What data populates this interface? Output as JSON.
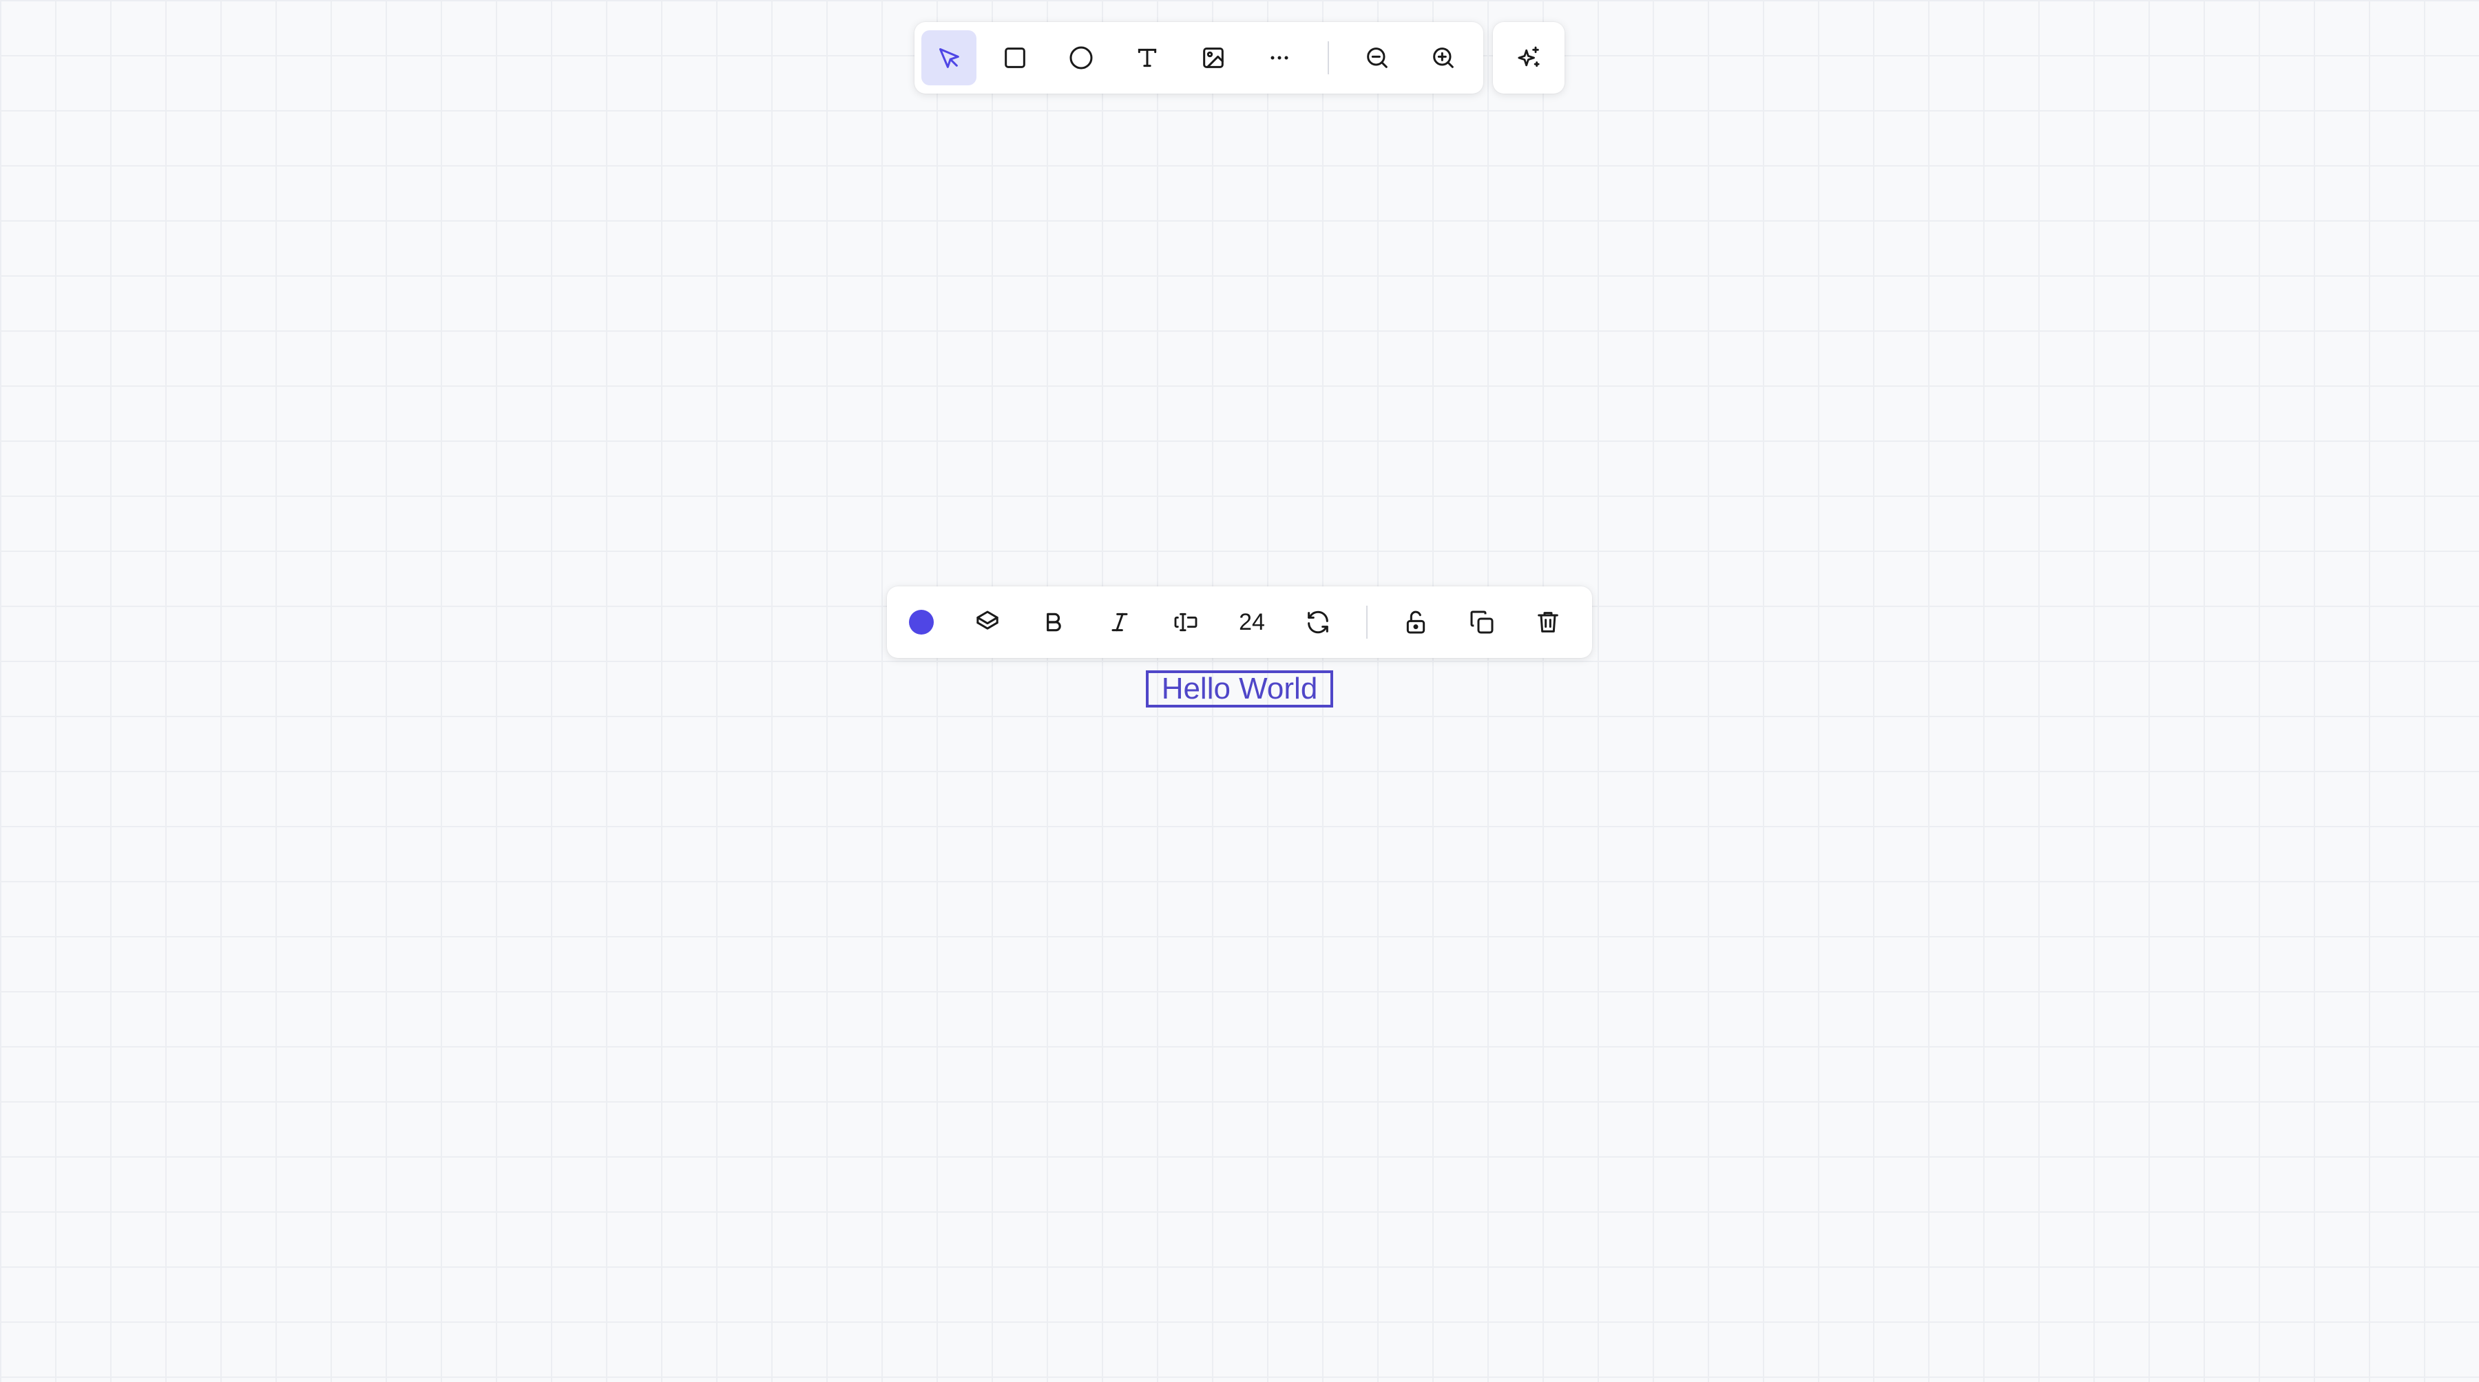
{
  "main_toolbar": {
    "tools": [
      {
        "name": "select",
        "icon": "cursor-icon",
        "active": true
      },
      {
        "name": "rectangle",
        "icon": "square-icon",
        "active": false
      },
      {
        "name": "ellipse",
        "icon": "circle-icon",
        "active": false
      },
      {
        "name": "text",
        "icon": "text-icon",
        "active": false
      },
      {
        "name": "image",
        "icon": "image-icon",
        "active": false
      },
      {
        "name": "more",
        "icon": "more-horizontal-icon",
        "active": false
      }
    ],
    "zoom": [
      {
        "name": "zoom-out",
        "icon": "zoom-out-icon"
      },
      {
        "name": "zoom-in",
        "icon": "zoom-in-icon"
      }
    ]
  },
  "ai_toolbar": {
    "icon": "sparkles-icon"
  },
  "element_toolbar": {
    "color": "#4f46e5",
    "font_size": "24",
    "buttons": [
      {
        "name": "color",
        "icon": "color-dot-icon"
      },
      {
        "name": "layers",
        "icon": "layers-icon"
      },
      {
        "name": "bold",
        "icon": "bold-icon"
      },
      {
        "name": "italic",
        "icon": "italic-icon"
      },
      {
        "name": "text-field",
        "icon": "text-cursor-input-icon"
      },
      {
        "name": "font-size",
        "icon": null
      },
      {
        "name": "rotate",
        "icon": "refresh-icon"
      },
      {
        "name": "lock",
        "icon": "unlock-icon"
      },
      {
        "name": "duplicate",
        "icon": "copy-icon"
      },
      {
        "name": "delete",
        "icon": "trash-icon"
      }
    ]
  },
  "canvas": {
    "text_element": {
      "text": "Hello World",
      "color": "#4f46c8",
      "selected": true
    }
  },
  "colors": {
    "accent": "#4f46e5",
    "active_tool_bg": "#e0e2fb",
    "canvas_bg": "#f8f9fb"
  }
}
